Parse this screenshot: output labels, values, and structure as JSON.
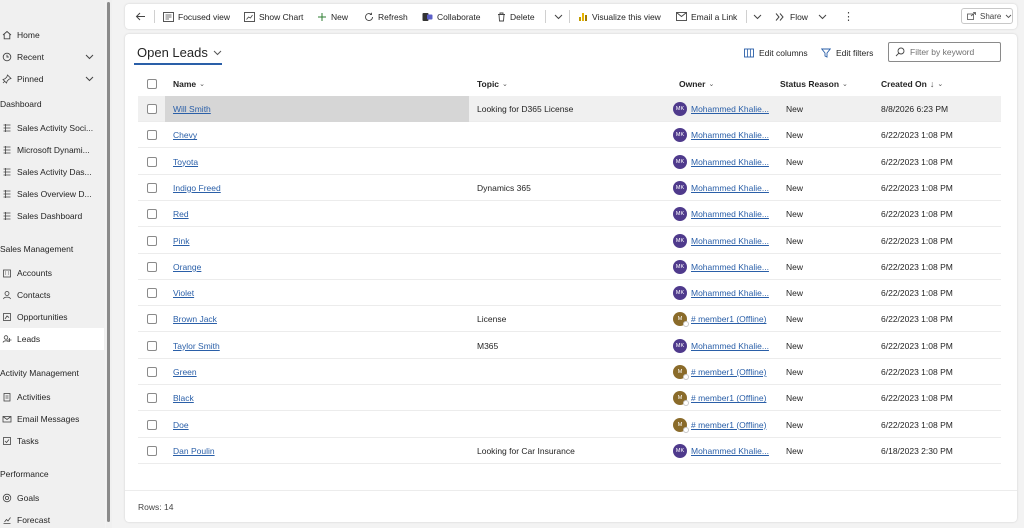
{
  "sidebar": {
    "top": [
      {
        "label": "Home",
        "icon": "home-icon"
      },
      {
        "label": "Recent",
        "icon": "clock-icon",
        "chevron": "chevron-down"
      },
      {
        "label": "Pinned",
        "icon": "pin-icon",
        "chevron": "chevron-down"
      }
    ],
    "sections": [
      {
        "title": "Dashboard",
        "items": [
          {
            "label": "Sales Activity Soci...",
            "icon": "dashboard-icon"
          },
          {
            "label": "Microsoft Dynami...",
            "icon": "dashboard-icon"
          },
          {
            "label": "Sales Activity Das...",
            "icon": "dashboard-icon"
          },
          {
            "label": "Sales Overview D...",
            "icon": "dashboard-icon"
          },
          {
            "label": "Sales Dashboard",
            "icon": "dashboard-icon"
          }
        ]
      },
      {
        "title": "Sales Management",
        "items": [
          {
            "label": "Accounts",
            "icon": "accounts-icon"
          },
          {
            "label": "Contacts",
            "icon": "contacts-icon"
          },
          {
            "label": "Opportunities",
            "icon": "opportunities-icon"
          },
          {
            "label": "Leads",
            "icon": "leads-icon",
            "active": true
          }
        ]
      },
      {
        "title": "Activity Management",
        "items": [
          {
            "label": "Activities",
            "icon": "activities-icon"
          },
          {
            "label": "Email Messages",
            "icon": "email-icon"
          },
          {
            "label": "Tasks",
            "icon": "tasks-icon"
          }
        ]
      },
      {
        "title": "Performance",
        "items": [
          {
            "label": "Goals",
            "icon": "goals-icon"
          },
          {
            "label": "Forecast",
            "icon": "forecast-icon"
          }
        ]
      }
    ]
  },
  "commandbar": {
    "focused_view": "Focused view",
    "show_chart": "Show Chart",
    "new": "New",
    "refresh": "Refresh",
    "collaborate": "Collaborate",
    "delete": "Delete",
    "visualize": "Visualize this view",
    "email_link": "Email a Link",
    "flow": "Flow",
    "share": "Share"
  },
  "view": {
    "title": "Open Leads",
    "edit_columns": "Edit columns",
    "edit_filters": "Edit filters",
    "search_placeholder": "Filter by keyword"
  },
  "grid": {
    "columns": {
      "name": "Name",
      "topic": "Topic",
      "owner": "Owner",
      "status": "Status Reason",
      "created": "Created On"
    },
    "rows": [
      {
        "name": "Will Smith",
        "topic": "Looking for D365 License",
        "owner": "Mohammed Khalie...",
        "owner_initials": "MK",
        "status": "New",
        "created": "8/8/2026 6:23 PM"
      },
      {
        "name": "Chevy",
        "topic": "",
        "owner": "Mohammed Khalie...",
        "owner_initials": "MK",
        "status": "New",
        "created": "6/22/2023 1:08 PM"
      },
      {
        "name": "Toyota",
        "topic": "",
        "owner": "Mohammed Khalie...",
        "owner_initials": "MK",
        "status": "New",
        "created": "6/22/2023 1:08 PM"
      },
      {
        "name": "Indigo Freed",
        "topic": "Dynamics 365",
        "owner": "Mohammed Khalie...",
        "owner_initials": "MK",
        "status": "New",
        "created": "6/22/2023 1:08 PM"
      },
      {
        "name": "Red",
        "topic": "",
        "owner": "Mohammed Khalie...",
        "owner_initials": "MK",
        "status": "New",
        "created": "6/22/2023 1:08 PM"
      },
      {
        "name": "Pink",
        "topic": "",
        "owner": "Mohammed Khalie...",
        "owner_initials": "MK",
        "status": "New",
        "created": "6/22/2023 1:08 PM"
      },
      {
        "name": "Orange",
        "topic": "",
        "owner": "Mohammed Khalie...",
        "owner_initials": "MK",
        "status": "New",
        "created": "6/22/2023 1:08 PM"
      },
      {
        "name": "Violet",
        "topic": "",
        "owner": "Mohammed Khalie...",
        "owner_initials": "MK",
        "status": "New",
        "created": "6/22/2023 1:08 PM"
      },
      {
        "name": "Brown Jack",
        "topic": "License",
        "owner": "# member1 (Offline)",
        "owner_initials": "M",
        "status": "New",
        "created": "6/22/2023 1:08 PM"
      },
      {
        "name": "Taylor Smith",
        "topic": "M365",
        "owner": "Mohammed Khalie...",
        "owner_initials": "MK",
        "status": "New",
        "created": "6/22/2023 1:08 PM"
      },
      {
        "name": "Green",
        "topic": "",
        "owner": "# member1 (Offline)",
        "owner_initials": "M",
        "status": "New",
        "created": "6/22/2023 1:08 PM"
      },
      {
        "name": "Black",
        "topic": "",
        "owner": "# member1 (Offline)",
        "owner_initials": "M",
        "status": "New",
        "created": "6/22/2023 1:08 PM"
      },
      {
        "name": "Doe",
        "topic": "",
        "owner": "# member1 (Offline)",
        "owner_initials": "M",
        "status": "New",
        "created": "6/22/2023 1:08 PM"
      },
      {
        "name": "Dan Poulin",
        "topic": "Looking for Car Insurance",
        "owner": "Mohammed Khalie...",
        "owner_initials": "MK",
        "status": "New",
        "created": "6/18/2023 2:30 PM"
      }
    ],
    "footer": "Rows: 14"
  },
  "colors": {
    "accent": "#2a5fa8",
    "avatar_mk": "#4f3a8c",
    "avatar_member": "#8a6b2a"
  }
}
